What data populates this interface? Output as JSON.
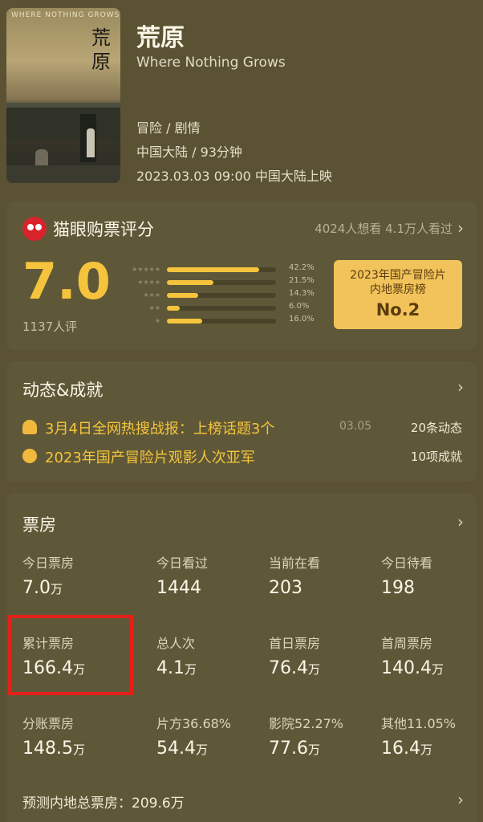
{
  "movie": {
    "poster_title": "WHERE NOTHING GROWS",
    "poster_chars": "荒原",
    "title": "荒原",
    "english_title": "Where Nothing Grows",
    "genres": "冒险 / 剧情",
    "region_duration": "中国大陆 / 93分钟",
    "release": "2023.03.03 09:00 中国大陆上映"
  },
  "rating": {
    "title": "猫眼购票评分",
    "want_watched": "4024人想看 4.1万人看过",
    "score": "7.0",
    "votes": "1137人评",
    "distribution": [
      {
        "stars": "★★★★★",
        "percent_label": "42.2%",
        "value": 42.2
      },
      {
        "stars": "★★★★",
        "percent_label": "21.5%",
        "value": 21.5
      },
      {
        "stars": "★★★",
        "percent_label": "14.3%",
        "value": 14.3
      },
      {
        "stars": "★★",
        "percent_label": "6.0%",
        "value": 6.0
      },
      {
        "stars": "★",
        "percent_label": "16.0%",
        "value": 16.0
      }
    ],
    "rank_line1": "2023年国产冒险片",
    "rank_line2": "内地票房榜",
    "rank_value": "No.2",
    "bar_color": "#f5c43c"
  },
  "dynamics": {
    "title": "动态&成就",
    "items": [
      {
        "icon": "bell-icon",
        "text": "3月4日全网热搜战报：上榜话题3个",
        "date": "03.05",
        "count": "20条动态"
      },
      {
        "icon": "medal-icon",
        "text": "2023年国产冒险片观影人次亚军",
        "date": "",
        "count": "10项成就"
      }
    ]
  },
  "boxoffice": {
    "title": "票房",
    "rows": [
      [
        {
          "label": "今日票房",
          "value": "7.0",
          "unit": "万"
        },
        {
          "label": "今日看过",
          "value": "1444",
          "unit": ""
        },
        {
          "label": "当前在看",
          "value": "203",
          "unit": ""
        },
        {
          "label": "今日待看",
          "value": "198",
          "unit": ""
        }
      ],
      [
        {
          "label": "累计票房",
          "value": "166.4",
          "unit": "万"
        },
        {
          "label": "总人次",
          "value": "4.1",
          "unit": "万"
        },
        {
          "label": "首日票房",
          "value": "76.4",
          "unit": "万"
        },
        {
          "label": "首周票房",
          "value": "140.4",
          "unit": "万"
        }
      ],
      [
        {
          "label": "分账票房",
          "value": "148.5",
          "unit": "万"
        },
        {
          "label": "片方36.68%",
          "value": "54.4",
          "unit": "万"
        },
        {
          "label": "影院52.27%",
          "value": "77.6",
          "unit": "万"
        },
        {
          "label": "其他11.05%",
          "value": "16.4",
          "unit": "万"
        }
      ]
    ],
    "forecast": "预测内地总票房：209.6万"
  }
}
